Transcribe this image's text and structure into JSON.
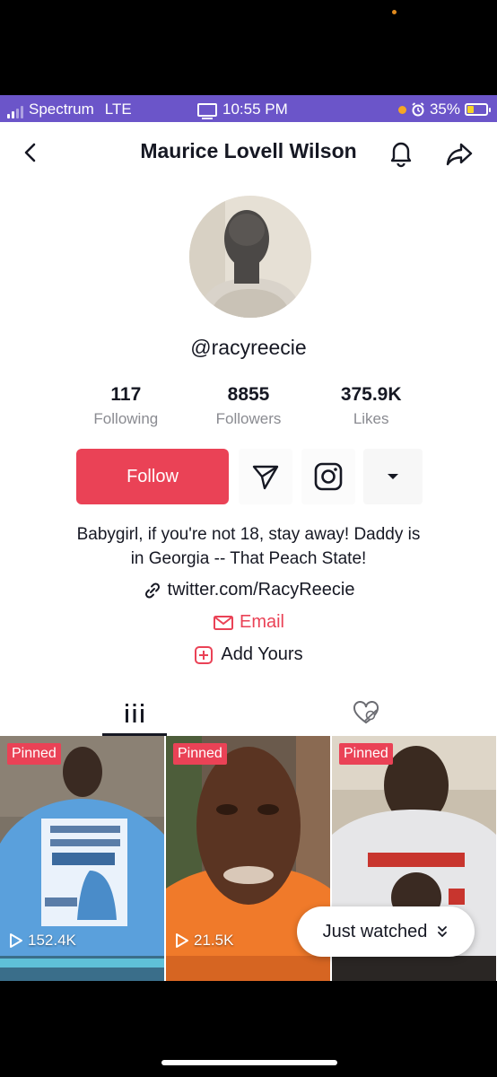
{
  "status_bar": {
    "carrier": "Spectrum",
    "network": "LTE",
    "time": "10:55 PM",
    "battery": "35%",
    "battery_fraction": 0.35,
    "background_color": "#6b55c9"
  },
  "header": {
    "title": "Maurice Lovell Wilson"
  },
  "profile": {
    "handle": "@racyreecie",
    "stats": [
      {
        "value": "117",
        "label": "Following"
      },
      {
        "value": "8855",
        "label": "Followers"
      },
      {
        "value": "375.9K",
        "label": "Likes"
      }
    ],
    "follow_label": "Follow",
    "bio_line1": "Babygirl, if you're not 18, stay away! Daddy is",
    "bio_line2": "in Georgia -- That Peach State!",
    "link": "twitter.com/RacyReecie",
    "email_label": "Email",
    "add_yours_label": "Add Yours"
  },
  "tabs": {
    "icons": [
      "grid-icon",
      "liked-hidden-icon"
    ]
  },
  "videos": [
    {
      "pinned": "Pinned",
      "views": "152.4K"
    },
    {
      "pinned": "Pinned",
      "views": "21.5K"
    },
    {
      "pinned": "Pinned",
      "views": ""
    }
  ],
  "just_watched": {
    "label": "Just watched"
  },
  "colors": {
    "accent": "#ea4256",
    "text": "#161823",
    "muted": "#8a8b91"
  }
}
